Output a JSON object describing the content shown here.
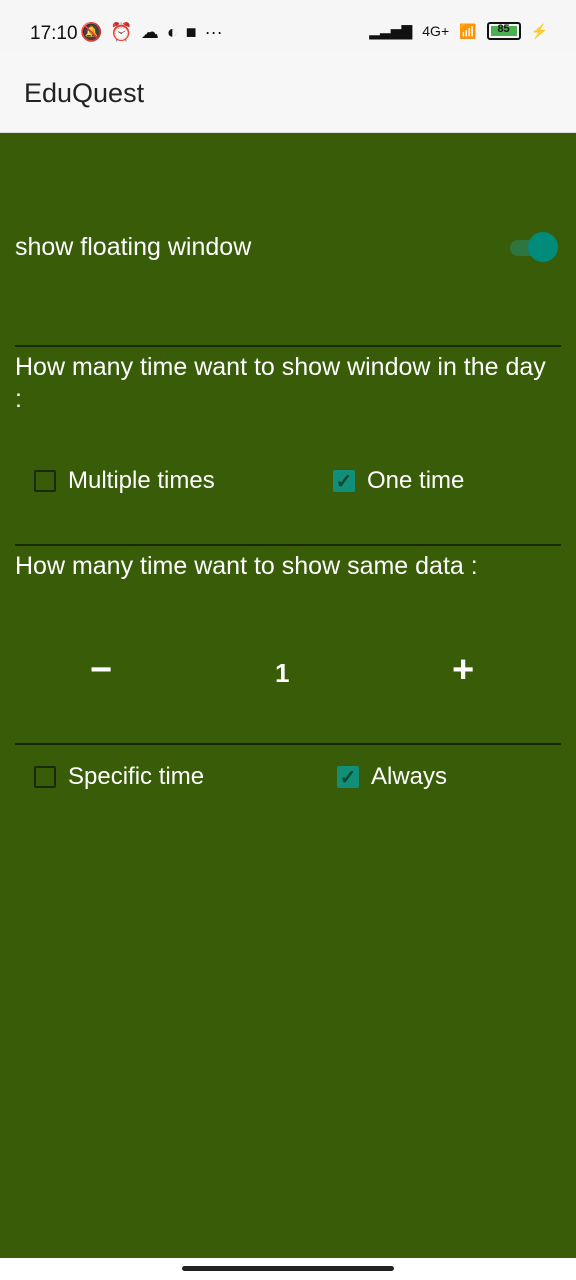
{
  "status_bar": {
    "time": "17:10",
    "left_icons": [
      "bell-off-icon",
      "alarm-icon",
      "cloud-icon",
      "app-icon",
      "square-icon"
    ],
    "more": "···",
    "network": "4G+",
    "battery": "85"
  },
  "app": {
    "title": "EduQuest"
  },
  "floating": {
    "label": "show floating window",
    "enabled": true
  },
  "frequency": {
    "question": "How many time want to show window in the day :",
    "options": [
      {
        "label": "Multiple times",
        "checked": false
      },
      {
        "label": "One time",
        "checked": true
      }
    ]
  },
  "repeat": {
    "question": "How many time want to show same data :",
    "decrement": "−",
    "value": "1",
    "increment": "+"
  },
  "schedule": {
    "options": [
      {
        "label": "Specific time",
        "checked": false
      },
      {
        "label": "Always",
        "checked": true
      }
    ]
  }
}
